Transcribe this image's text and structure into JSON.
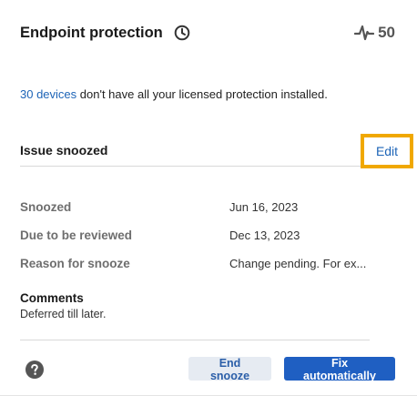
{
  "header": {
    "title": "Endpoint protection",
    "score": "50"
  },
  "notice": {
    "link_text": "30 devices",
    "text": " don't have all your licensed protection installed."
  },
  "section": {
    "title": "Issue snoozed",
    "edit_label": "Edit"
  },
  "details": [
    {
      "label": "Snoozed",
      "value": "Jun 16, 2023"
    },
    {
      "label": "Due to be reviewed",
      "value": "Dec 13, 2023"
    },
    {
      "label": "Reason for snooze",
      "value": "Change pending. For ex..."
    }
  ],
  "comments": {
    "title": "Comments",
    "text": "Deferred till later."
  },
  "footer": {
    "end_snooze_label": "End snooze",
    "fix_label": "Fix automatically"
  },
  "colors": {
    "link": "#1d64b7",
    "highlight_border": "#f0a800",
    "primary_button": "#1f5fc2",
    "secondary_button": "#e6ebf2"
  },
  "icons": {
    "clock": "clock-icon",
    "pulse": "pulse-icon",
    "help": "help-icon"
  }
}
